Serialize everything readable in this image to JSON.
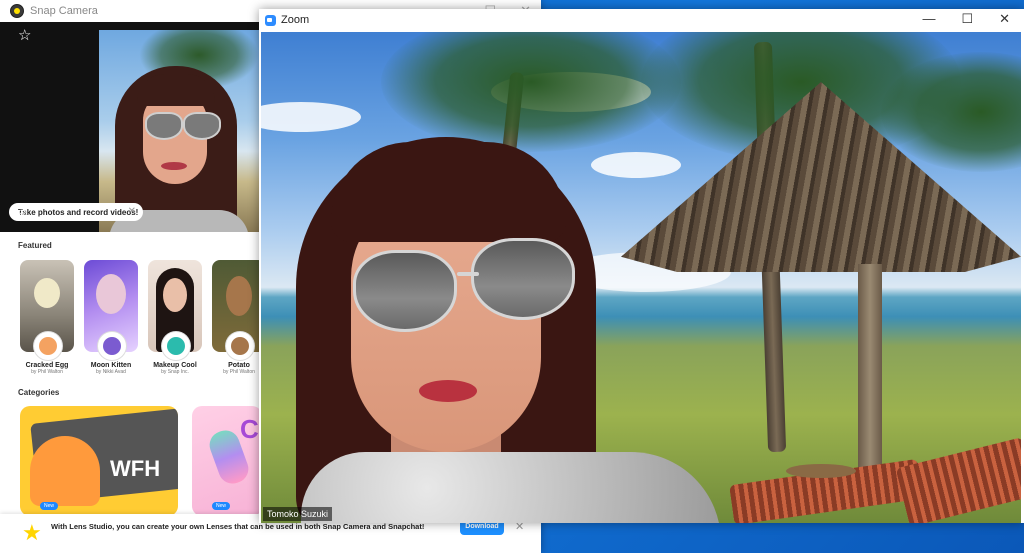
{
  "snap": {
    "title": "Snap Camera",
    "tooltip": "Take photos and record videos!",
    "featured_label": "Featured",
    "categories_label": "Categories",
    "lenses": [
      {
        "name": "Cracked Egg",
        "author": "by Phil Walton"
      },
      {
        "name": "Moon Kitten",
        "author": "by Nikki Avad"
      },
      {
        "name": "Makeup Cool",
        "author": "by Snap Inc."
      },
      {
        "name": "Potato",
        "author": "by Phil Walton"
      }
    ],
    "category_cards": [
      {
        "label": "WFH",
        "badge": "New"
      },
      {
        "label": "C",
        "badge": "New"
      }
    ],
    "banner_text": "With Lens Studio, you can create your own Lenses that can be used in both Snap Camera and Snapchat!",
    "download_label": "Download"
  },
  "zoom": {
    "title": "Zoom",
    "participant_name": "Tomoko Suzuki"
  },
  "icons": {
    "star": "☆",
    "camera": "◎",
    "close": "✕",
    "minimize": "—",
    "maximize": "☐",
    "banner_star": "★"
  }
}
